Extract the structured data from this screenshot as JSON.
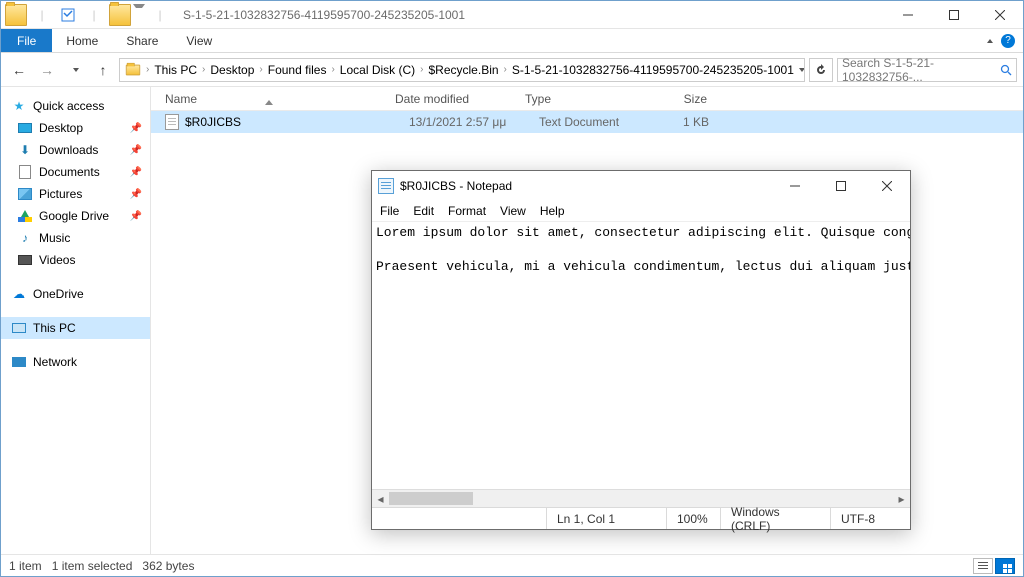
{
  "explorer": {
    "title": "S-1-5-21-1032832756-4119595700-245235205-1001",
    "tabs": {
      "file": "File",
      "home": "Home",
      "share": "Share",
      "view": "View"
    },
    "breadcrumb": [
      "This PC",
      "Desktop",
      "Found files",
      "Local Disk (C)",
      "$Recycle.Bin",
      "S-1-5-21-1032832756-4119595700-245235205-1001"
    ],
    "search_placeholder": "Search S-1-5-21-1032832756-...",
    "nav": {
      "quick_access": "Quick access",
      "items": [
        {
          "label": "Desktop"
        },
        {
          "label": "Downloads"
        },
        {
          "label": "Documents"
        },
        {
          "label": "Pictures"
        },
        {
          "label": "Google Drive"
        },
        {
          "label": "Music"
        },
        {
          "label": "Videos"
        }
      ],
      "onedrive": "OneDrive",
      "thispc": "This PC",
      "network": "Network"
    },
    "columns": {
      "name": "Name",
      "date": "Date modified",
      "type": "Type",
      "size": "Size"
    },
    "rows": [
      {
        "name": "$R0JICBS",
        "date": "13/1/2021 2:57 μμ",
        "type": "Text Document",
        "size": "1 KB"
      }
    ],
    "status": {
      "count": "1 item",
      "selection": "1 item selected",
      "bytes": "362 bytes"
    }
  },
  "notepad": {
    "title": "$R0JICBS - Notepad",
    "menu": {
      "file": "File",
      "edit": "Edit",
      "format": "Format",
      "view": "View",
      "help": "Help"
    },
    "content": "Lorem ipsum dolor sit amet, consectetur adipiscing elit. Quisque congue iac\n\nPraesent vehicula, mi a vehicula condimentum, lectus dui aliquam justo, qui",
    "status": {
      "pos": "Ln 1, Col 1",
      "zoom": "100%",
      "eol": "Windows (CRLF)",
      "enc": "UTF-8"
    }
  }
}
